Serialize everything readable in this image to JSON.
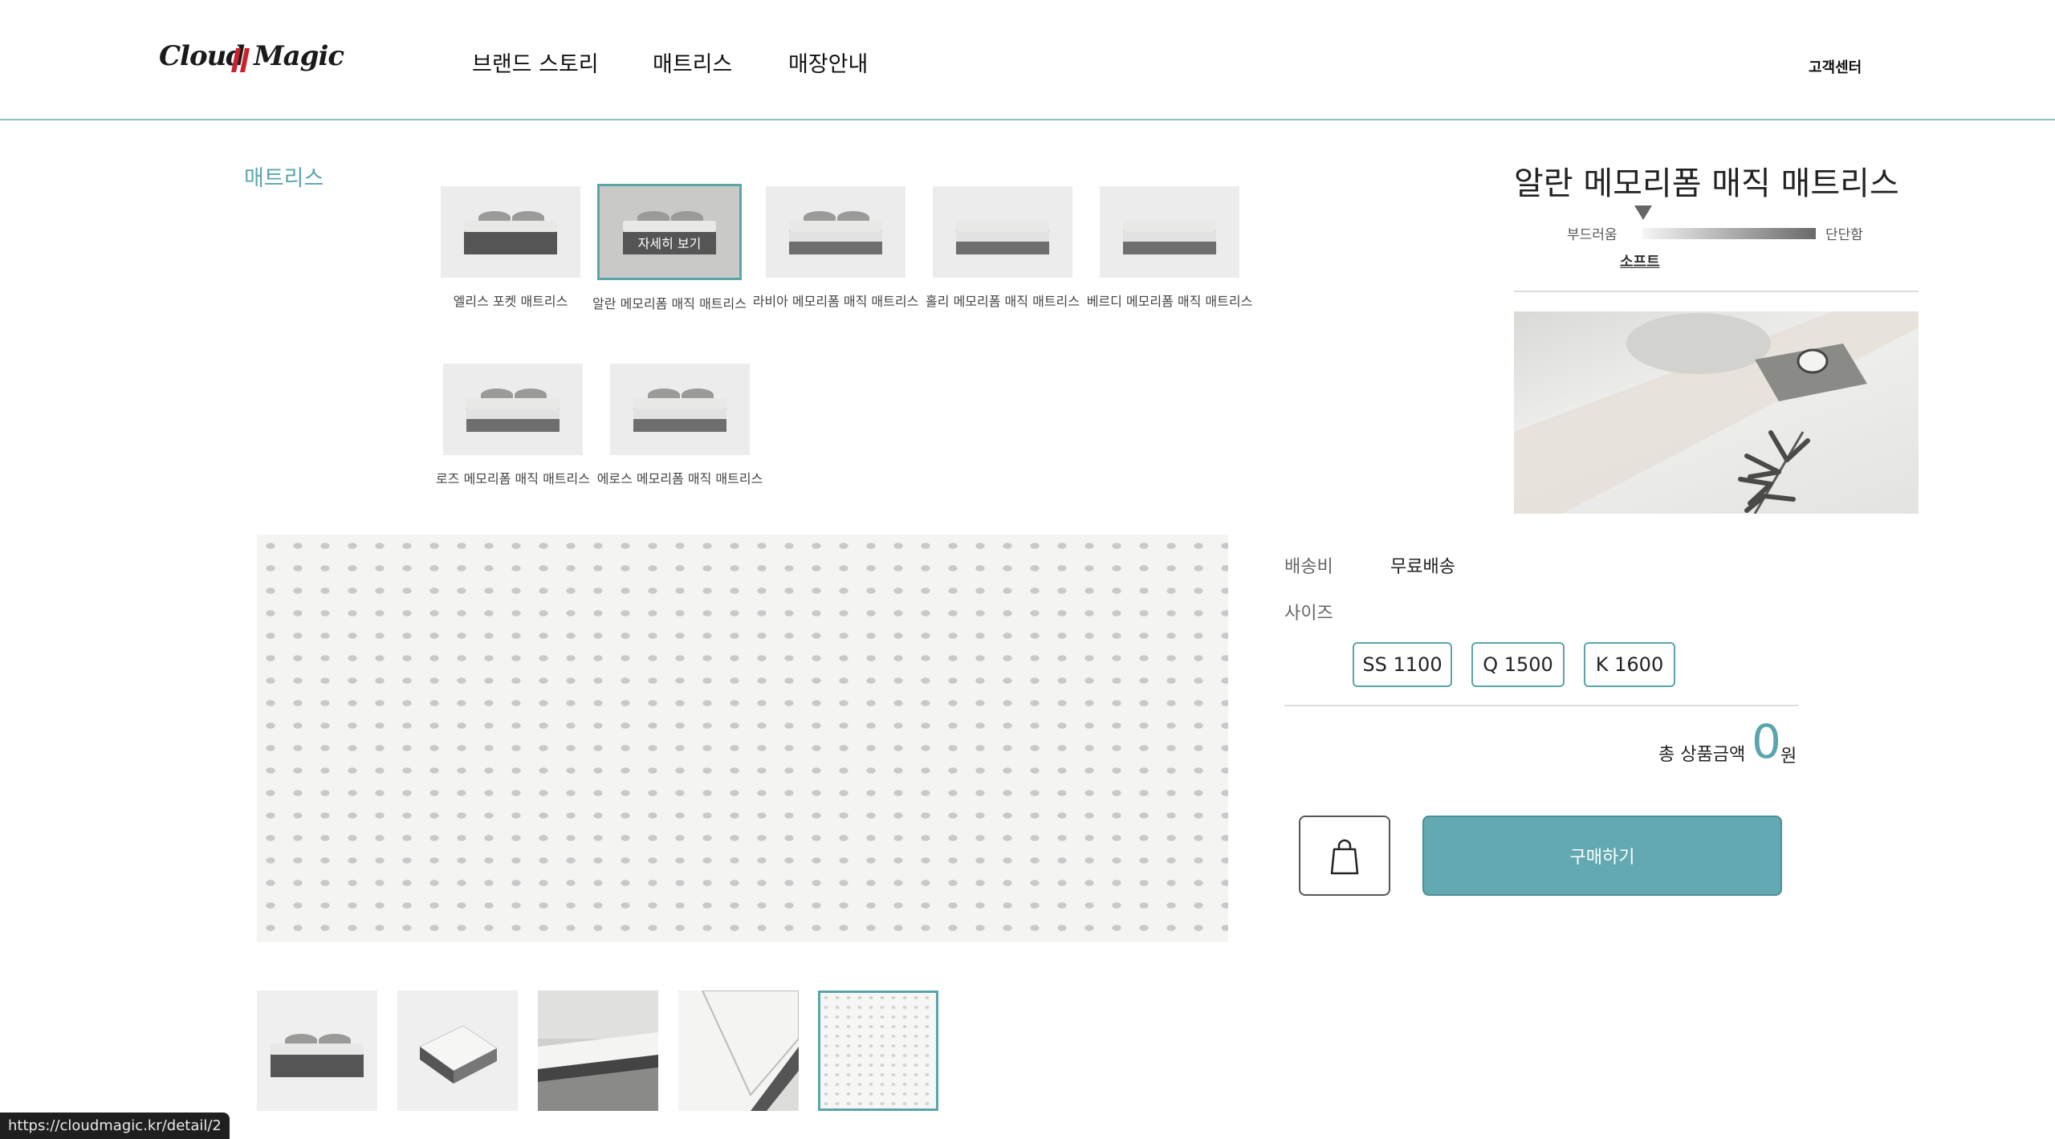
{
  "header": {
    "logo": {
      "word1": "Cloud",
      "word2": "Magic"
    },
    "nav": [
      "브랜드 스토리",
      "매트리스",
      "매장안내"
    ],
    "customer_center": "고객센터"
  },
  "category": "매트리스",
  "products": [
    {
      "name": "엘리스 포켓 매트리스",
      "selected": false
    },
    {
      "name": "알란 메모리폼 매직 매트리스",
      "selected": true,
      "overlay": "자세히 보기"
    },
    {
      "name": "라비아 메모리폼 매직 매트리스",
      "selected": false
    },
    {
      "name": "홀리 메모리폼 매직 매트리스",
      "selected": false
    },
    {
      "name": "베르디 메모리폼 매직 매트리스",
      "selected": false
    },
    {
      "name": "로즈 메모리폼 매직 매트리스",
      "selected": false
    },
    {
      "name": "에로스 메모리폼 매직 매트리스",
      "selected": false
    }
  ],
  "product": {
    "title": "알란 메모리폼 매직 매트리스",
    "firmness": {
      "soft_label": "부드러움",
      "firm_label": "단단함",
      "value": "소프트"
    }
  },
  "order": {
    "shipping_label": "배송비",
    "shipping_value": "무료배송",
    "size_label": "사이즈",
    "sizes": [
      "SS 1100",
      "Q 1500",
      "K 1600"
    ],
    "total_label": "총 상품금액",
    "total_amount": "0",
    "currency": "원",
    "buy_label": "구매하기"
  },
  "gallery": {
    "count": 5,
    "selected_index": 4
  },
  "status_url": "https://cloudmagic.kr/detail/2",
  "colors": {
    "accent": "#5aa5ad",
    "buy_button": "#62a9b1",
    "header_line": "#8cc3c7"
  }
}
